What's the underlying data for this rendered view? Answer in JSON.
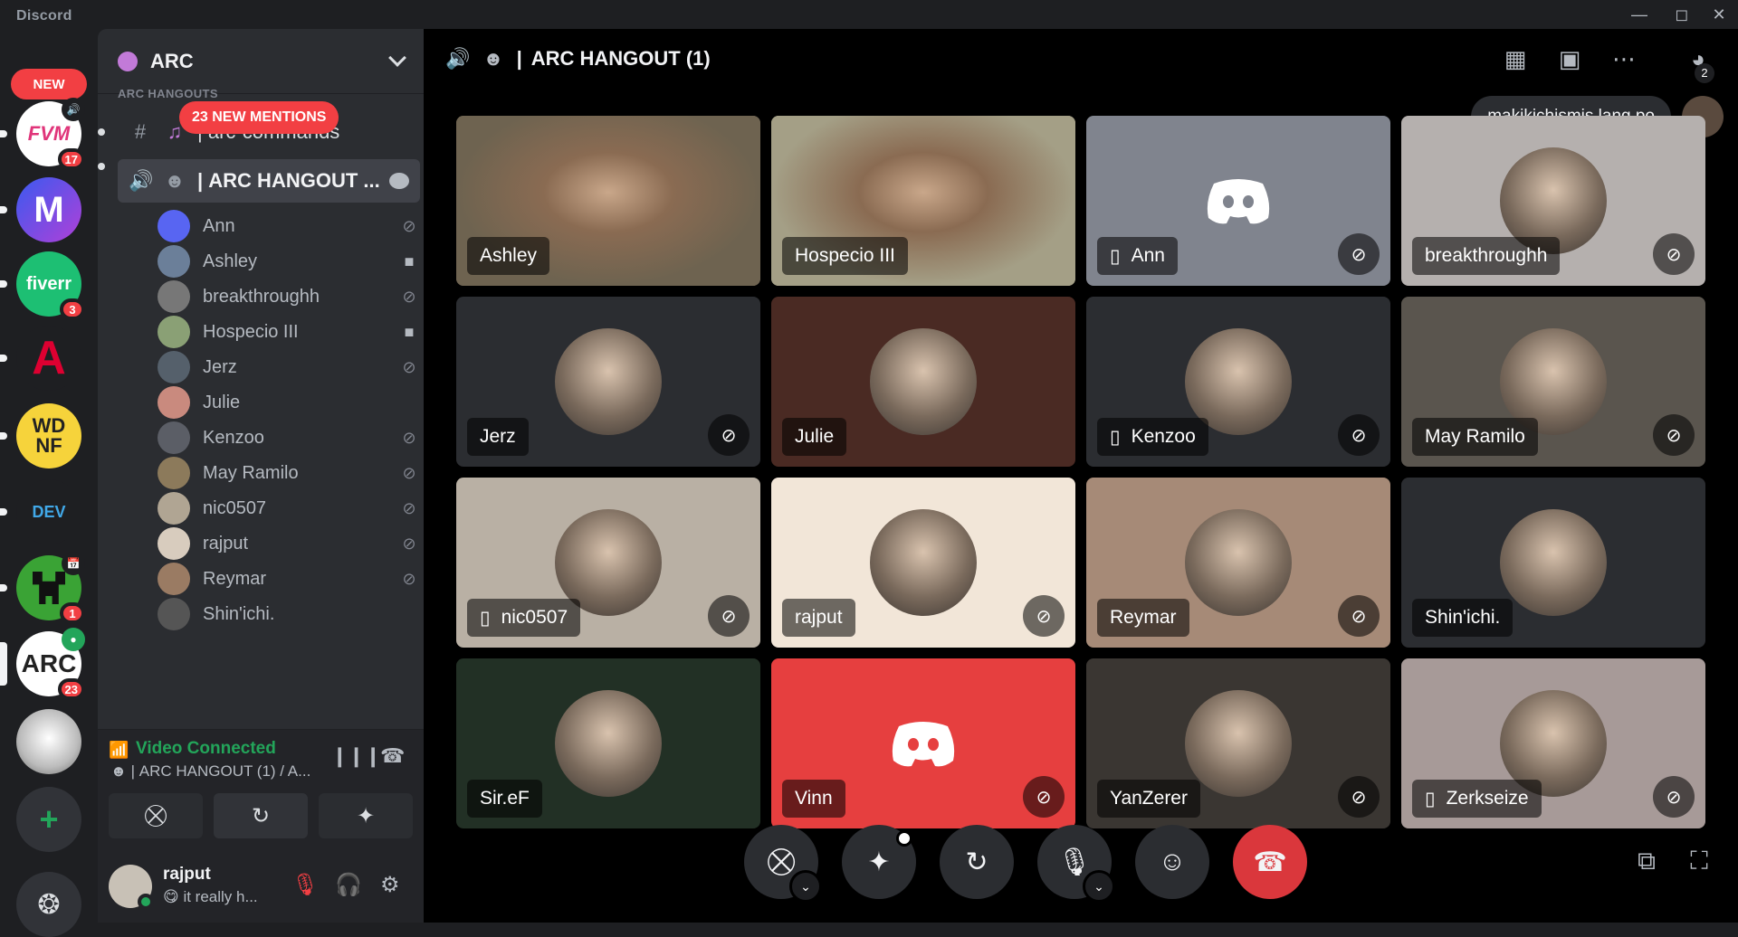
{
  "app": {
    "title": "Discord",
    "window_controls": [
      "minimize",
      "maximize",
      "close"
    ]
  },
  "servers": {
    "new_label": "NEW",
    "items": [
      {
        "name": "server-fvm",
        "initials": "FVM",
        "badge": "17",
        "color": "#ffffff"
      },
      {
        "name": "server-m",
        "initials": "M",
        "badge": "",
        "color": "#5b3bd6"
      },
      {
        "name": "server-fiverr",
        "initials": "fiverr",
        "badge": "3",
        "color": "#1dbf73"
      },
      {
        "name": "server-a",
        "initials": "A",
        "badge": "",
        "color": "#c3002f"
      },
      {
        "name": "server-wdnf",
        "initials": "WD NF",
        "badge": "",
        "color": "#f6d33b"
      },
      {
        "name": "server-flutter-dev",
        "initials": "DEV",
        "badge": "",
        "color": "#1e1f22"
      },
      {
        "name": "server-creeper",
        "initials": "",
        "badge": "1",
        "color": "#3aa335"
      },
      {
        "name": "server-arc",
        "initials": "ARC",
        "badge": "23",
        "color": "#ffffff"
      },
      {
        "name": "server-cat",
        "initials": "",
        "badge": "",
        "color": "#c9c9c9"
      }
    ]
  },
  "sidebar": {
    "guild_name": "ARC",
    "category": "ARC HANGOUTS",
    "mentions_label": "23 NEW MENTIONS",
    "text_channel": "arc-commands",
    "voice_channel": "ARC HANGOUT ...",
    "voice_users": [
      {
        "name": "Ann",
        "state": "muted",
        "color": "#5865f2"
      },
      {
        "name": "Ashley",
        "state": "video",
        "color": "#6b7f99"
      },
      {
        "name": "breakthroughh",
        "state": "muted",
        "color": "#777"
      },
      {
        "name": "Hospecio III",
        "state": "video",
        "color": "#8aa075"
      },
      {
        "name": "Jerz",
        "state": "muted",
        "color": "#55606b"
      },
      {
        "name": "Julie",
        "state": "",
        "color": "#c98a7e"
      },
      {
        "name": "Kenzoo",
        "state": "muted",
        "color": "#5b5e66"
      },
      {
        "name": "May Ramilo",
        "state": "muted",
        "color": "#8c7a5b"
      },
      {
        "name": "nic0507",
        "state": "muted",
        "color": "#b0a593"
      },
      {
        "name": "rajput",
        "state": "muted",
        "color": "#d8ccbe"
      },
      {
        "name": "Reymar",
        "state": "muted",
        "color": "#9a7b63"
      },
      {
        "name": "Shin'ichi.",
        "state": "",
        "color": "#555"
      }
    ],
    "voice_status": "Video Connected",
    "voice_location": "ARC HANGOUT (1) / A...",
    "user": {
      "name": "rajput",
      "status": "😋 it really h..."
    }
  },
  "stage": {
    "channel_title": "ARC HANGOUT (1)",
    "notification_count": "2",
    "popup_text": "makikichismis lang po",
    "tiles": [
      {
        "name": "Ashley",
        "bg": "#6e6350",
        "mobile": false,
        "muted": false,
        "video": true
      },
      {
        "name": "Hospecio III",
        "bg": "#a49f86",
        "mobile": false,
        "muted": false,
        "video": true
      },
      {
        "name": "Ann",
        "bg": "#80848e",
        "mobile": true,
        "muted": true,
        "discord": true
      },
      {
        "name": "breakthroughh",
        "bg": "#b5b0ae",
        "mobile": false,
        "muted": true
      },
      {
        "name": "Jerz",
        "bg": "#2b2d31",
        "mobile": false,
        "muted": true
      },
      {
        "name": "Julie",
        "bg": "#4a2a23",
        "mobile": false,
        "muted": false
      },
      {
        "name": "Kenzoo",
        "bg": "#2b2d31",
        "mobile": true,
        "muted": true
      },
      {
        "name": "May Ramilo",
        "bg": "#5a554e",
        "mobile": false,
        "muted": true
      },
      {
        "name": "nic0507",
        "bg": "#b9b0a4",
        "mobile": true,
        "muted": true
      },
      {
        "name": "rajput",
        "bg": "#f2e6d8",
        "mobile": false,
        "muted": true
      },
      {
        "name": "Reymar",
        "bg": "#a68a77",
        "mobile": false,
        "muted": true
      },
      {
        "name": "Shin'ichi.",
        "bg": "#2b2d31",
        "mobile": false,
        "muted": false
      },
      {
        "name": "Sir.eF",
        "bg": "#223025",
        "mobile": false,
        "muted": false
      },
      {
        "name": "Vinn",
        "bg": "#e63f3f",
        "mobile": false,
        "muted": true,
        "discord": true
      },
      {
        "name": "YanZerer",
        "bg": "#3a3632",
        "mobile": false,
        "muted": true
      },
      {
        "name": "Zerkseize",
        "bg": "#a79a98",
        "mobile": true,
        "muted": true
      }
    ],
    "controls": [
      "camera-off",
      "activities",
      "screen-share",
      "mic-muted",
      "emoji",
      "disconnect"
    ]
  }
}
